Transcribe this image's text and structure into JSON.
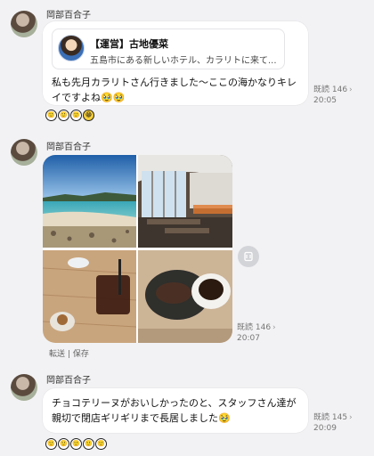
{
  "messages": [
    {
      "sender": "岡部百合子",
      "card": {
        "title": "【運営】古地優菜",
        "subtitle": "五島市にある新しいホテル、カラリトに来て..."
      },
      "text_line1": "私も先月カラリトさん行きました〜ここの海かなりキレ",
      "text_line2": "イですよね🥹🥹",
      "read": "既読 146",
      "time": "20:05",
      "reactions": [
        "🙂",
        "🙂",
        "🙂",
        "😁"
      ]
    },
    {
      "sender": "岡部百合子",
      "photos": [
        "beach",
        "restaurant-interior",
        "iced-coffee",
        "hot-coffee-and-cake"
      ],
      "read": "既読 146",
      "time": "20:07",
      "forward_label": "転送",
      "save_label": "保存",
      "separator": "|"
    },
    {
      "sender": "岡部百合子",
      "text_line1": "チョコテリーヌがおいしかったのと、スタッフさん達が",
      "text_line2": "親切で閉店ギリギリまで長居しました🥹",
      "read": "既読 145",
      "time": "20:09",
      "reactions": [
        "🙂",
        "🙂",
        "🙂",
        "🙂",
        "🙂"
      ]
    }
  ],
  "icons": {
    "chevron": "›"
  }
}
